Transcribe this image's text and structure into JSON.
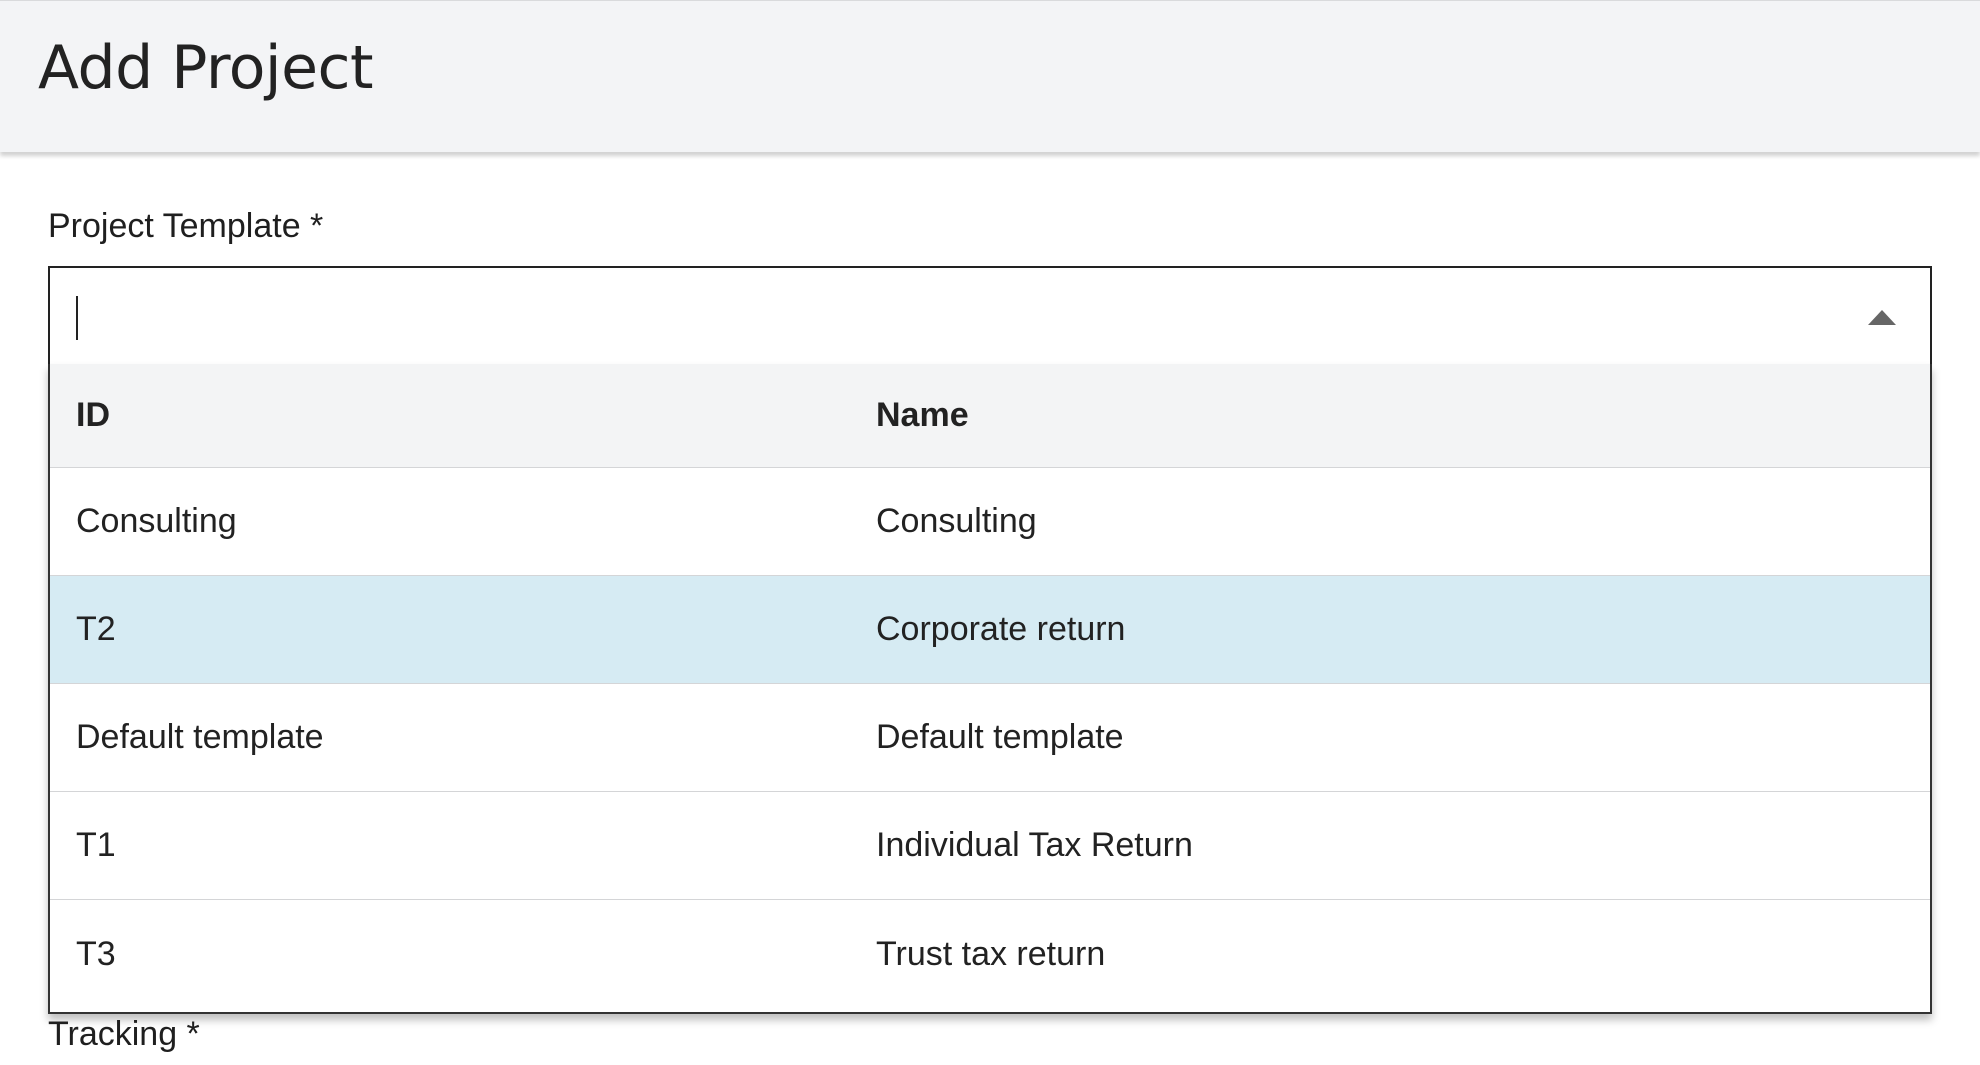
{
  "header": {
    "title": "Add Project"
  },
  "project_template": {
    "label": "Project Template *",
    "value": "",
    "placeholder": ""
  },
  "dropdown": {
    "columns": {
      "id": "ID",
      "name": "Name"
    },
    "rows": [
      {
        "id": "Consulting",
        "name": "Consulting",
        "selected": false
      },
      {
        "id": "T2",
        "name": "Corporate return",
        "selected": true
      },
      {
        "id": "Default template",
        "name": "Default template",
        "selected": false
      },
      {
        "id": "T1",
        "name": "Individual Tax Return",
        "selected": false
      },
      {
        "id": "T3",
        "name": "Trust tax return",
        "selected": false
      }
    ]
  },
  "tracking": {
    "label": "Tracking *"
  },
  "colors": {
    "header_bg": "#f3f4f6",
    "selected_row_bg": "#d6ebf3",
    "table_header_bg": "#f3f4f5"
  }
}
